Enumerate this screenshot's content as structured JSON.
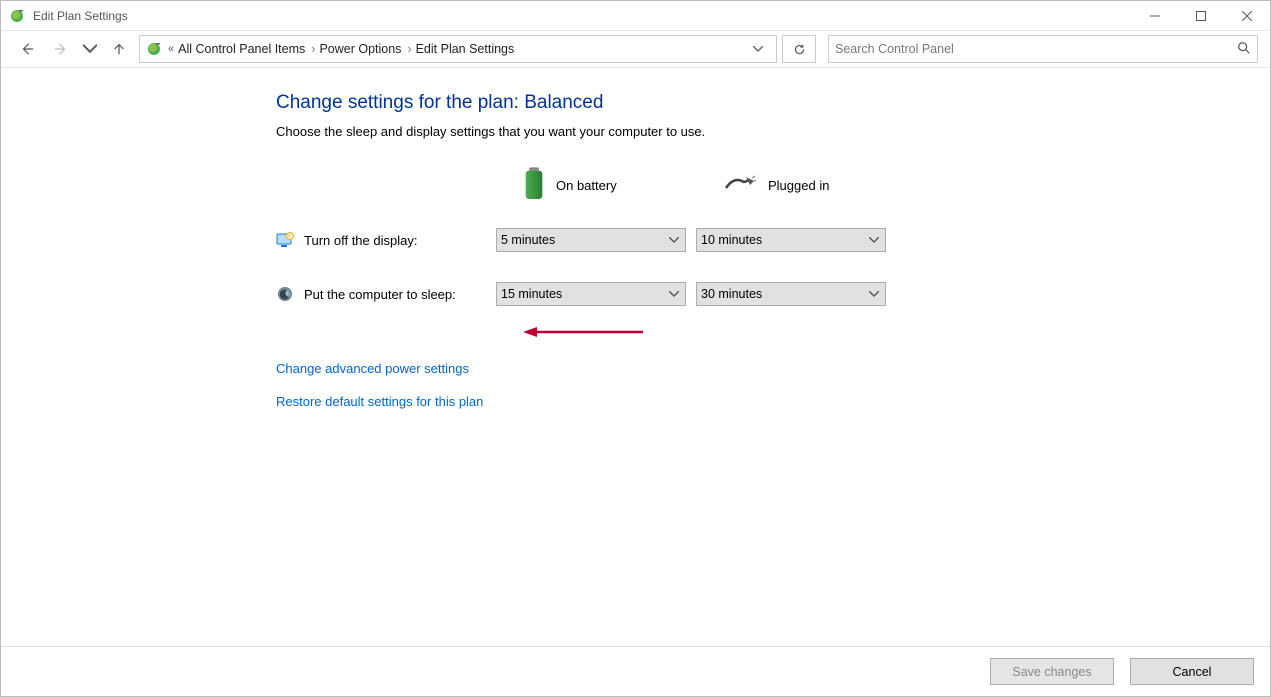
{
  "window": {
    "title": "Edit Plan Settings"
  },
  "breadcrumb": {
    "items": [
      {
        "label": "All Control Panel Items"
      },
      {
        "label": "Power Options"
      },
      {
        "label": "Edit Plan Settings"
      }
    ]
  },
  "search": {
    "placeholder": "Search Control Panel"
  },
  "page": {
    "heading": "Change settings for the plan: Balanced",
    "subtext": "Choose the sleep and display settings that you want your computer to use.",
    "columns": {
      "battery": "On battery",
      "plugged": "Plugged in"
    },
    "rows": {
      "display": {
        "label": "Turn off the display:",
        "battery_value": "5 minutes",
        "plugged_value": "10 minutes"
      },
      "sleep": {
        "label": "Put the computer to sleep:",
        "battery_value": "15 minutes",
        "plugged_value": "30 minutes"
      }
    },
    "links": {
      "advanced": "Change advanced power settings",
      "restore": "Restore default settings for this plan"
    }
  },
  "footer": {
    "save": "Save changes",
    "cancel": "Cancel"
  }
}
